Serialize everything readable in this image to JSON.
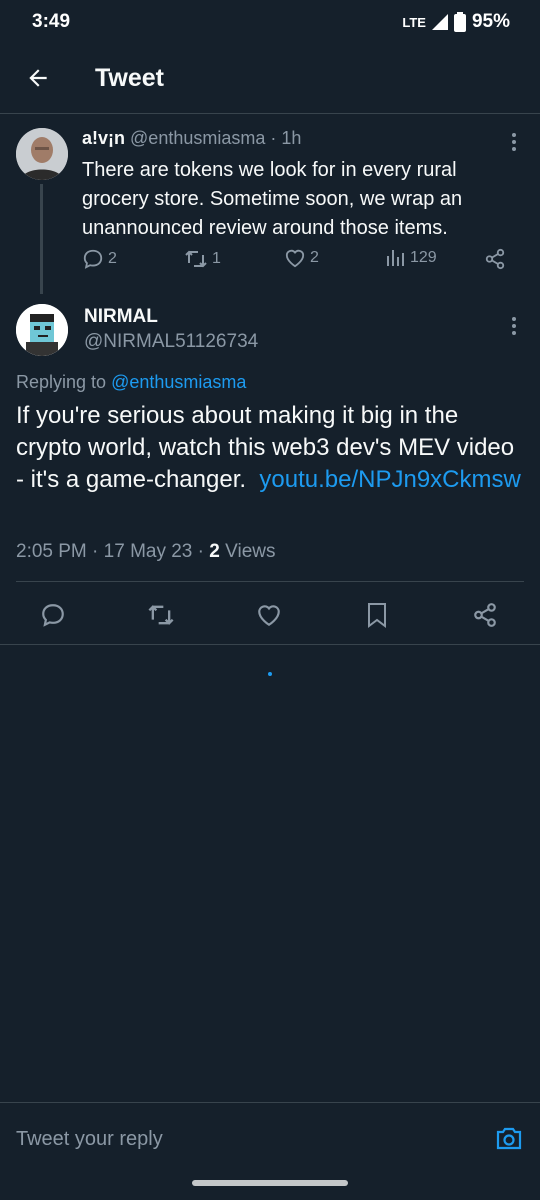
{
  "status_bar": {
    "time": "3:49",
    "network": "LTE",
    "battery": "95%"
  },
  "header": {
    "title": "Tweet"
  },
  "parent_tweet": {
    "name": "a!v¡n",
    "handle": "@enthusmiasma",
    "time": "1h",
    "text": "There are tokens we look for in every rural grocery store. Sometime soon, we wrap an unannounced review around those items.",
    "replies": "2",
    "retweets": "1",
    "likes": "2",
    "views": "129"
  },
  "main_tweet": {
    "name": "NIRMAL",
    "handle": "@NIRMAL51126734",
    "replying_label": "Replying to",
    "replying_to": "@enthusmiasma",
    "text": "If you're serious about making it big in the crypto world, watch this web3 dev's MEV video - it's a game-changer.",
    "link_line1": "youtu.be/",
    "link_line2": "NPJn9xCkmsw",
    "time": "2:05 PM",
    "date": "17 May 23",
    "views_count": "2",
    "views_label": "Views"
  },
  "reply_bar": {
    "placeholder": "Tweet your reply"
  },
  "colors": {
    "background": "#15202b",
    "accent": "#1d9bf0",
    "muted": "#8b98a5",
    "border": "#38444d"
  },
  "icons": [
    "back-arrow-icon",
    "more-icon",
    "reply-icon",
    "retweet-icon",
    "like-icon",
    "views-icon",
    "share-icon",
    "bookmark-icon",
    "camera-icon",
    "signal-icon",
    "battery-icon"
  ]
}
